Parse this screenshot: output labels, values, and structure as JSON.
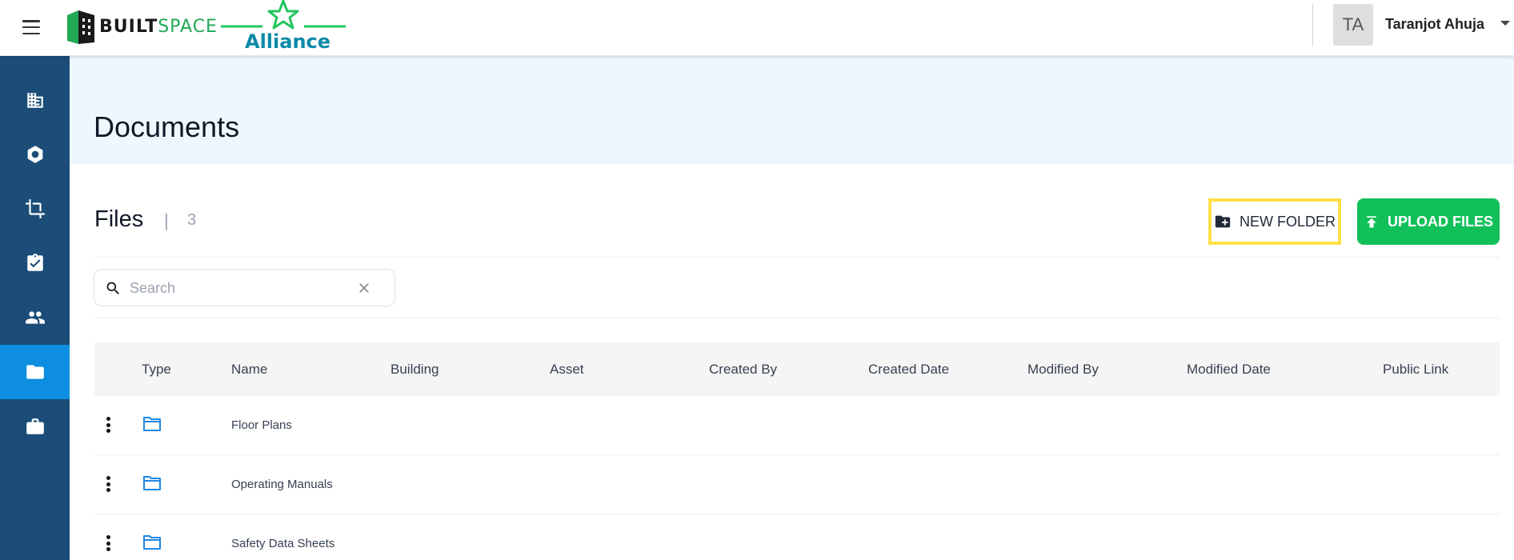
{
  "header": {
    "logo_built": "BUILT",
    "logo_space": "SPACE",
    "alliance_label": "Alliance",
    "user_initials": "TA",
    "user_name": "Taranjot Ahuja"
  },
  "sidebar": {
    "items": [
      {
        "icon": "building-icon",
        "active": false
      },
      {
        "icon": "hexagon-icon",
        "active": false
      },
      {
        "icon": "crop-icon",
        "active": false
      },
      {
        "icon": "clipboard-check-icon",
        "active": false
      },
      {
        "icon": "people-icon",
        "active": false
      },
      {
        "icon": "folder-icon",
        "active": true
      },
      {
        "icon": "briefcase-icon",
        "active": false
      }
    ]
  },
  "page": {
    "title": "Documents"
  },
  "files": {
    "title": "Files",
    "separator": "|",
    "count": "3",
    "new_folder_label": "NEW FOLDER",
    "upload_label": "UPLOAD FILES",
    "search_placeholder": "Search"
  },
  "table": {
    "columns": [
      "Type",
      "Name",
      "Building",
      "Asset",
      "Created By",
      "Created Date",
      "Modified By",
      "Modified Date",
      "Public Link"
    ],
    "rows": [
      {
        "type": "folder",
        "name": "Floor Plans"
      },
      {
        "type": "folder",
        "name": "Operating Manuals"
      },
      {
        "type": "folder",
        "name": "Safety Data Sheets"
      }
    ]
  },
  "colors": {
    "sidebar_bg": "#1b4d78",
    "sidebar_active": "#0d8ee0",
    "upload_button": "#12c05a",
    "highlight_border": "#fde047",
    "folder_icon": "#1e88e5"
  }
}
